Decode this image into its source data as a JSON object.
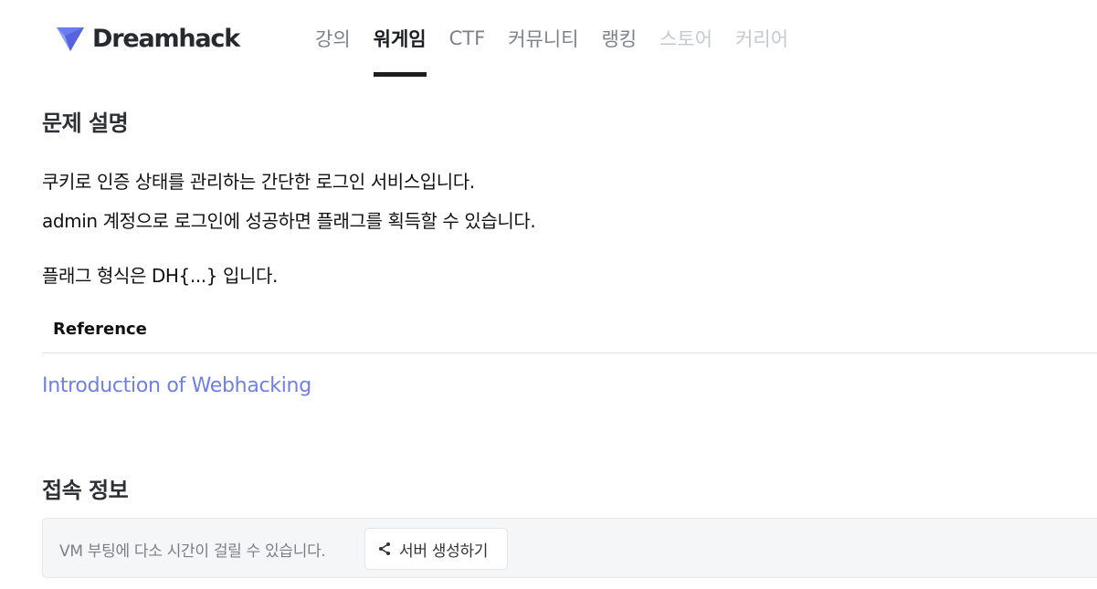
{
  "brand": {
    "name": "Dreamhack",
    "logo_color": "#6b7cf0"
  },
  "nav": {
    "items": [
      {
        "label": "강의",
        "state": "normal"
      },
      {
        "label": "워게임",
        "state": "active"
      },
      {
        "label": "CTF",
        "state": "normal"
      },
      {
        "label": "커뮤니티",
        "state": "normal"
      },
      {
        "label": "랭킹",
        "state": "normal"
      },
      {
        "label": "스토어",
        "state": "disabled"
      },
      {
        "label": "커리어",
        "state": "disabled"
      }
    ]
  },
  "problem": {
    "title": "문제 설명",
    "lines": [
      "쿠키로 인증 상태를 관리하는 간단한 로그인 서비스입니다.",
      "admin 계정으로 로그인에 성공하면 플래그를 획득할 수 있습니다.",
      "플래그 형식은 DH{...} 입니다."
    ]
  },
  "reference": {
    "header": "Reference",
    "link_text": "Introduction of Webhacking",
    "link_color": "#6f7fe3"
  },
  "connection": {
    "title": "접속 정보",
    "notice": "VM 부팅에 다소 시간이 걸릴 수 있습니다.",
    "button_label": "서버 생성하기",
    "button_icon": "share-icon"
  }
}
